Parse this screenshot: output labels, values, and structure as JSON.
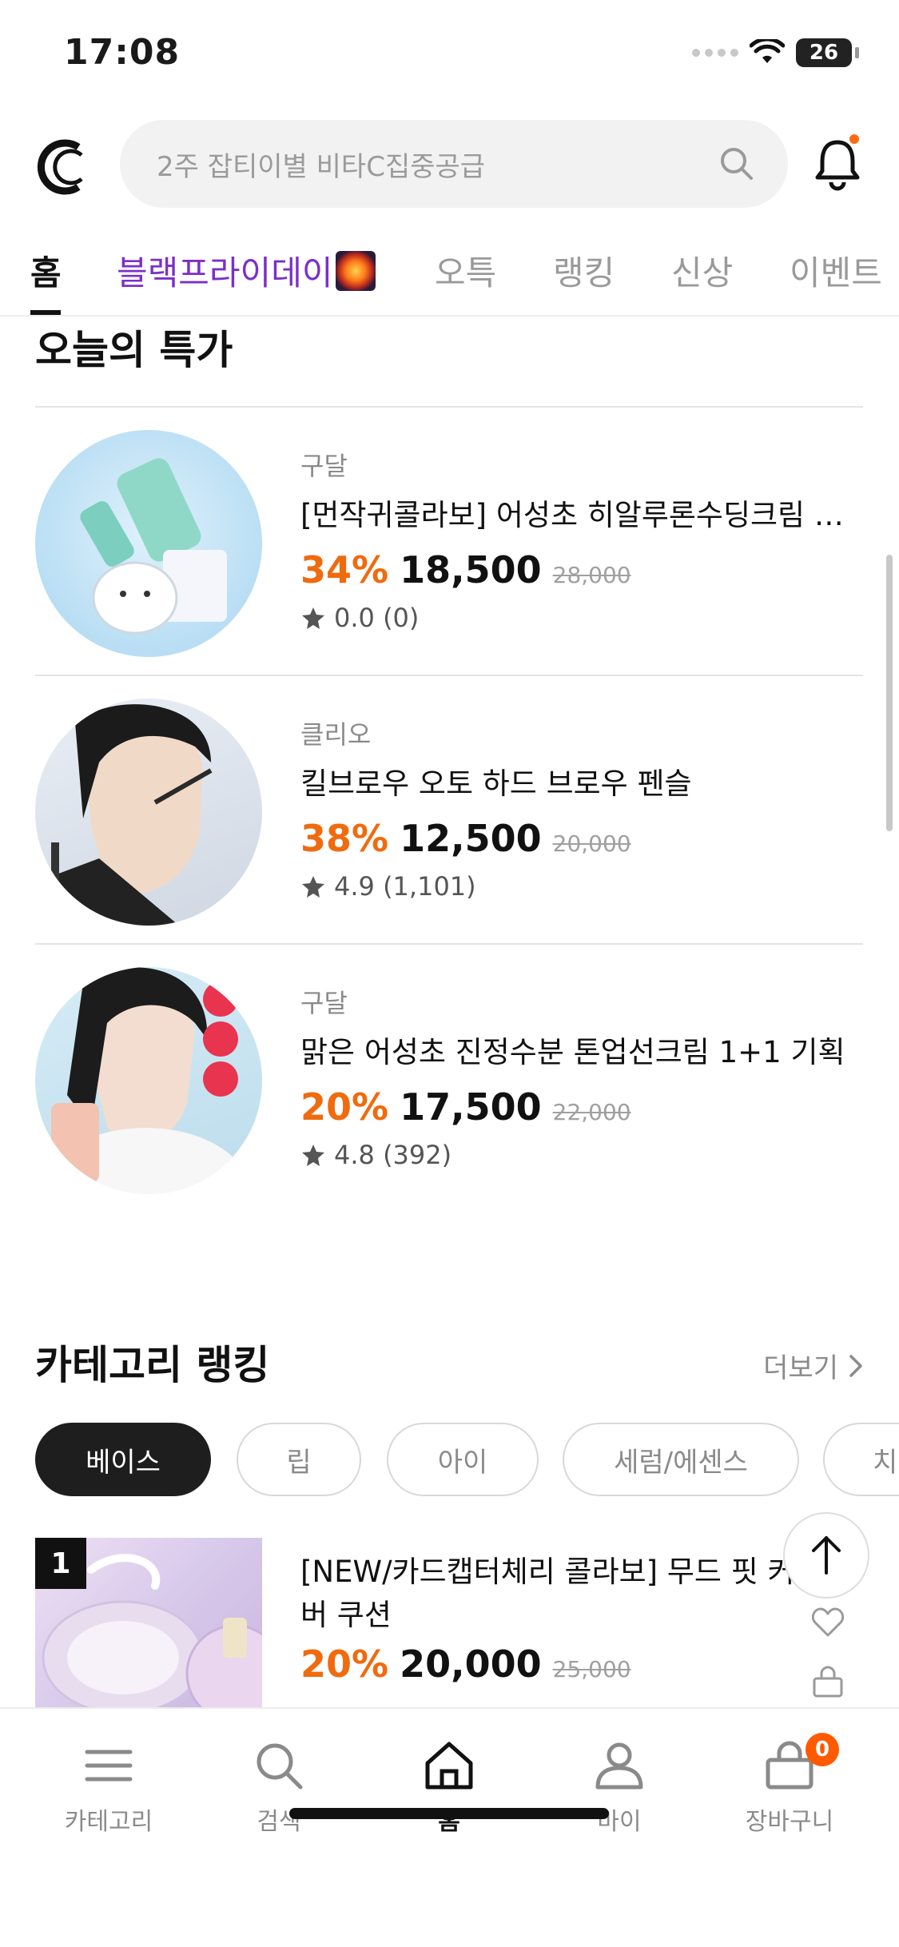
{
  "status_bar": {
    "time": "17:08",
    "battery": "26"
  },
  "header": {
    "search_placeholder": "2주 잡티이별 비타C집중공급"
  },
  "tabs": [
    {
      "label": "홈"
    },
    {
      "label": "블랙프라이데이"
    },
    {
      "label": "오특"
    },
    {
      "label": "랭킹"
    },
    {
      "label": "신상"
    },
    {
      "label": "이벤트"
    }
  ],
  "todays_deal": {
    "title": "오늘의 특가",
    "items": [
      {
        "brand": "구달",
        "name": "[먼작귀콜라보] 어성초 히알루론수딩크림 …",
        "discount": "34%",
        "price": "18,500",
        "original": "28,000",
        "rating": "0.0 (0)"
      },
      {
        "brand": "클리오",
        "name": "킬브로우 오토 하드 브로우 펜슬",
        "discount": "38%",
        "price": "12,500",
        "original": "20,000",
        "rating": "4.9 (1,101)"
      },
      {
        "brand": "구달",
        "name": "맑은 어성초 진정수분 톤업선크림 1+1 기획",
        "discount": "20%",
        "price": "17,500",
        "original": "22,000",
        "rating": "4.8 (392)"
      }
    ]
  },
  "category_ranking": {
    "title": "카테고리 랭킹",
    "more": "더보기",
    "chips": [
      "베이스",
      "립",
      "아이",
      "세럼/에센스",
      "치"
    ],
    "item": {
      "rank": "1",
      "name": "[NEW/카드캡터체리 콜라보] 무드 핏 커버 쿠션",
      "discount": "20%",
      "price": "20,000",
      "original": "25,000"
    }
  },
  "bottom_nav": [
    {
      "label": "카테고리",
      "icon": "menu-icon"
    },
    {
      "label": "검색",
      "icon": "search-icon"
    },
    {
      "label": "홈",
      "icon": "home-icon"
    },
    {
      "label": "마이",
      "icon": "person-icon"
    },
    {
      "label": "장바구니",
      "icon": "cart-icon"
    }
  ],
  "cart_count": "0",
  "colors": {
    "accent": "#f06a0e",
    "purple_tab": "#7b2fc9",
    "dark_chip": "#1e1e1e"
  }
}
